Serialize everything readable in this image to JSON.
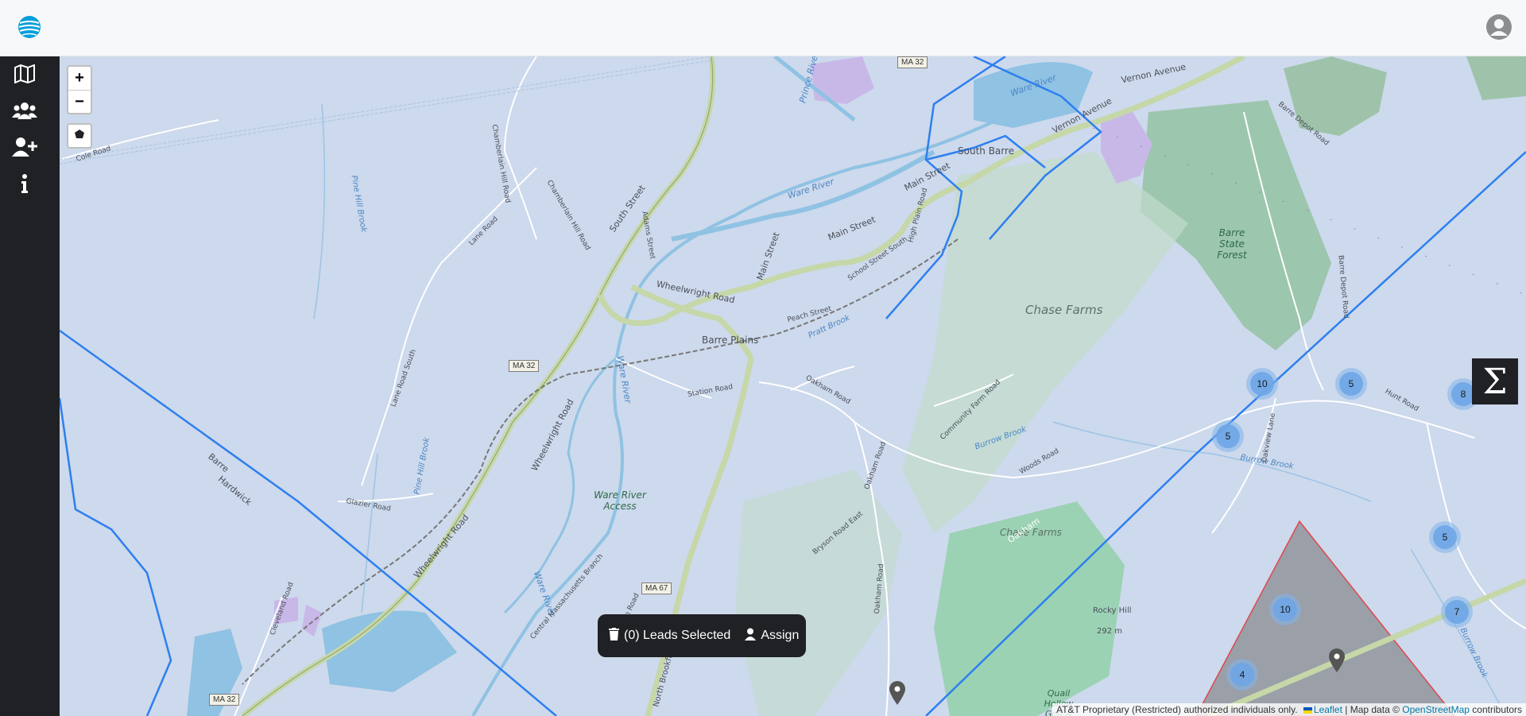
{
  "header": {
    "logo_icon": "att-globe-logo",
    "avatar_icon": "user-avatar-icon"
  },
  "sidebar": {
    "items": [
      {
        "icon": "map-icon",
        "name": "map"
      },
      {
        "icon": "users-icon",
        "name": "users"
      },
      {
        "icon": "user-plus-icon",
        "name": "add-user"
      },
      {
        "icon": "info-icon",
        "name": "info"
      }
    ]
  },
  "map": {
    "zoom_in_label": "+",
    "zoom_out_label": "−",
    "draw_polygon_icon": "polygon-icon",
    "labels": {
      "ma32_top": "MA 32",
      "ma32_mid": "MA 32",
      "ma32_bottom": "MA 32",
      "ma67": "MA 67",
      "ware_river_1": "Ware River",
      "ware_river_2": "Ware River",
      "ware_river_3": "Ware River",
      "ware_river_4": "Ware River",
      "prince_river": "Prince River",
      "south_barre": "South Barre",
      "barre_plains": "Barre Plains",
      "chase_farms_1": "Chase Farms",
      "chase_farms_2": "Chase Farms",
      "barre_state_forest": "Barre State Forest",
      "ware_river_access": "Ware River Access",
      "rocky_hill": "Rocky Hill",
      "rocky_hill_elev": "292 m",
      "quail_hollow": "Quail Hollow Golf &",
      "cole_road": "Cole Road",
      "pine_hill_brook_1": "Pine Hill Brook",
      "pine_hill_brook_2": "Pine Hill Brook",
      "barre": "Barre",
      "hardwick": "Hardwick",
      "wheelwright_road_1": "Wheelwright Road",
      "wheelwright_road_2": "Wheelwright Road",
      "wheelwright_road_3": "Wheelwright Road",
      "main_street_1": "Main Street",
      "main_street_2": "Main Street",
      "main_street_3": "Main Street",
      "south_street": "South Street",
      "vernon_avenue_1": "Vernon Avenue",
      "vernon_avenue_2": "Vernon Avenue",
      "oakham_road_1": "Oakham Road",
      "oakham_road_2": "Oakham Road",
      "oakham_road_3": "Oakham Road",
      "oakham": "Oakham",
      "station_road": "Station Road",
      "woods_road": "Woods Road",
      "burrow_brook_1": "Burrow Brook",
      "burrow_brook_2": "Burrow Brook",
      "burrow_brook_3": "Burrow Brook",
      "barre_depot_road_1": "Barre Depot Road",
      "barre_depot_road_2": "Barre Depot Road",
      "north_brookfield_road": "North Brookfield Road",
      "cleveland_road": "Cleveland Road",
      "glazier_road": "Glazier Road",
      "lane_road": "Lane Road",
      "lane_road_south": "Lane Road South",
      "chamberlain_hill_road_1": "Chamberlain Hill Road",
      "chamberlain_hill_road_2": "Chamberlain Hill Road",
      "peach_street": "Peach Street",
      "school_street_south": "School Street South",
      "high_plain_road": "High Plain Road",
      "adams_street": "Adams Street",
      "community_farm_road": "Community Farm Road",
      "bryson_road_east": "Bryson Road East",
      "quinn_road": "Quinn Road",
      "central_mass_branch": "Central Massachusetts Branch",
      "pratt_brook": "Pratt Brook",
      "hunt_road": "Hunt Road",
      "oakview_lane": "Oakview Lane"
    },
    "clusters": [
      {
        "name": "cluster-10-a",
        "count": "10"
      },
      {
        "name": "cluster-5-a",
        "count": "5"
      },
      {
        "name": "cluster-8",
        "count": "8"
      },
      {
        "name": "cluster-5-b",
        "count": "5"
      },
      {
        "name": "cluster-5-c",
        "count": "5"
      },
      {
        "name": "cluster-10-b",
        "count": "10"
      },
      {
        "name": "cluster-7",
        "count": "7"
      },
      {
        "name": "cluster-4",
        "count": "4"
      }
    ],
    "attribution": {
      "text": "AT&T Proprietary (Restricted) authorized individuals only.",
      "leaflet": "Leaflet",
      "separator": " | Map data © ",
      "osm": "OpenStreetMap",
      "contributors": " contributors"
    },
    "colors": {
      "boundary": "#2d7ff0",
      "selection_fill": "#7f8084",
      "selection_stroke": "#e0474f"
    }
  },
  "summary_button": {
    "label": "Σ"
  },
  "leads_bar": {
    "count_label": "(0) Leads Selected",
    "assign_label": "Assign",
    "trash_icon": "trash-icon",
    "person_icon": "person-icon"
  }
}
